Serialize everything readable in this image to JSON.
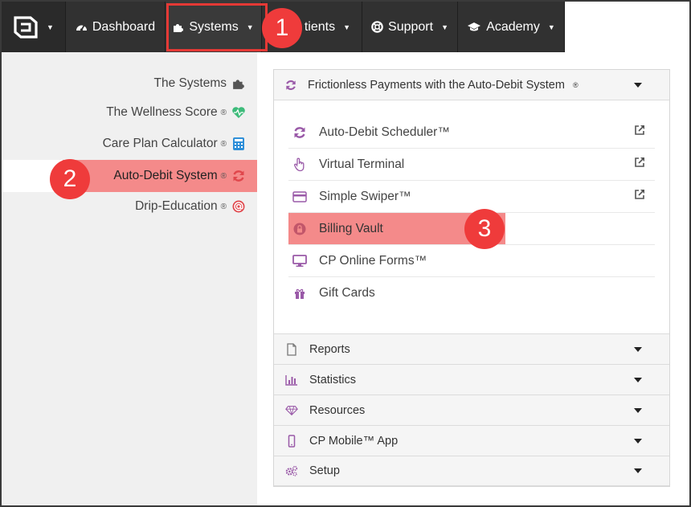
{
  "nav": {
    "dashboard": "Dashboard",
    "systems": "Systems",
    "patients": "tients",
    "support": "Support",
    "academy": "Academy"
  },
  "badges": {
    "one": "1",
    "two": "2",
    "three": "3"
  },
  "sidebar": {
    "items": [
      {
        "label": "The Systems",
        "icon": "puzzle-icon",
        "reg": ""
      },
      {
        "label": "The Wellness Score",
        "icon": "heart-pulse-icon",
        "reg": "®"
      },
      {
        "label": "Care Plan Calculator",
        "icon": "calculator-icon",
        "reg": "®"
      },
      {
        "label": "Auto-Debit System",
        "icon": "refresh-icon",
        "reg": "®"
      },
      {
        "label": "Drip-Education",
        "icon": "at-icon",
        "reg": "®"
      }
    ]
  },
  "panel": {
    "header": "Frictionless Payments with the Auto-Debit System",
    "header_reg": "®",
    "items": [
      {
        "label": "Auto-Debit Scheduler™",
        "icon": "refresh-icon",
        "external": true
      },
      {
        "label": "Virtual Terminal",
        "icon": "hand-pointer-icon",
        "external": true
      },
      {
        "label": "Simple Swiper™",
        "icon": "credit-card-icon",
        "external": true
      },
      {
        "label": "Billing Vault",
        "icon": "lock-icon",
        "external": false
      },
      {
        "label": "CP Online Forms™",
        "icon": "monitor-icon",
        "external": false
      },
      {
        "label": "Gift Cards",
        "icon": "gift-icon",
        "external": false
      }
    ],
    "sections": [
      {
        "label": "Reports",
        "icon": "file-icon"
      },
      {
        "label": "Statistics",
        "icon": "bar-chart-icon"
      },
      {
        "label": "Resources",
        "icon": "diamond-icon"
      },
      {
        "label": "CP Mobile™ App",
        "icon": "mobile-icon"
      },
      {
        "label": "Setup",
        "icon": "cogs-icon"
      }
    ]
  },
  "colors": {
    "nav_bg": "#313131",
    "highlight": "#f48a8a",
    "badge": "#ef3b3b",
    "icon_purple": "#9a5aa8",
    "heart_green": "#3dbb7a",
    "calc_blue": "#2f8fd8",
    "refresh_red": "#e0474c"
  }
}
